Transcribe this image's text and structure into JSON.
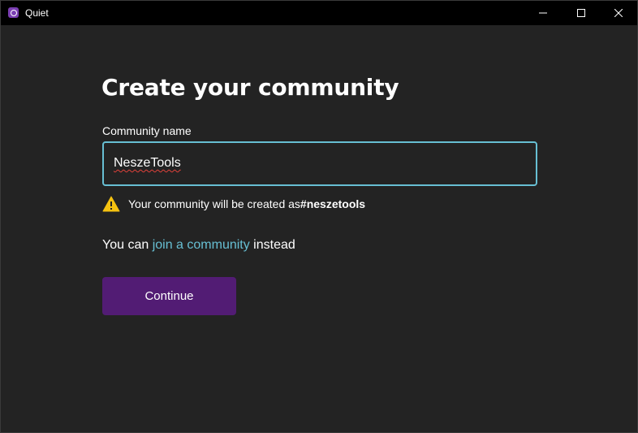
{
  "window": {
    "title": "Quiet",
    "icon": "quiet-app-icon"
  },
  "page": {
    "title": "Create your community",
    "field_label": "Community name",
    "input_value": "NeszeTools",
    "warning_icon": "warning-triangle-icon",
    "warning_text": "Your community will be created as ",
    "warning_name": "#neszetools",
    "alt_prefix": "You can ",
    "alt_link": "join a community",
    "alt_suffix": " instead",
    "continue_label": "Continue"
  },
  "colors": {
    "background": "#232323",
    "accent": "#67bfd3",
    "button": "#521c74",
    "warning": "#f5c211"
  }
}
